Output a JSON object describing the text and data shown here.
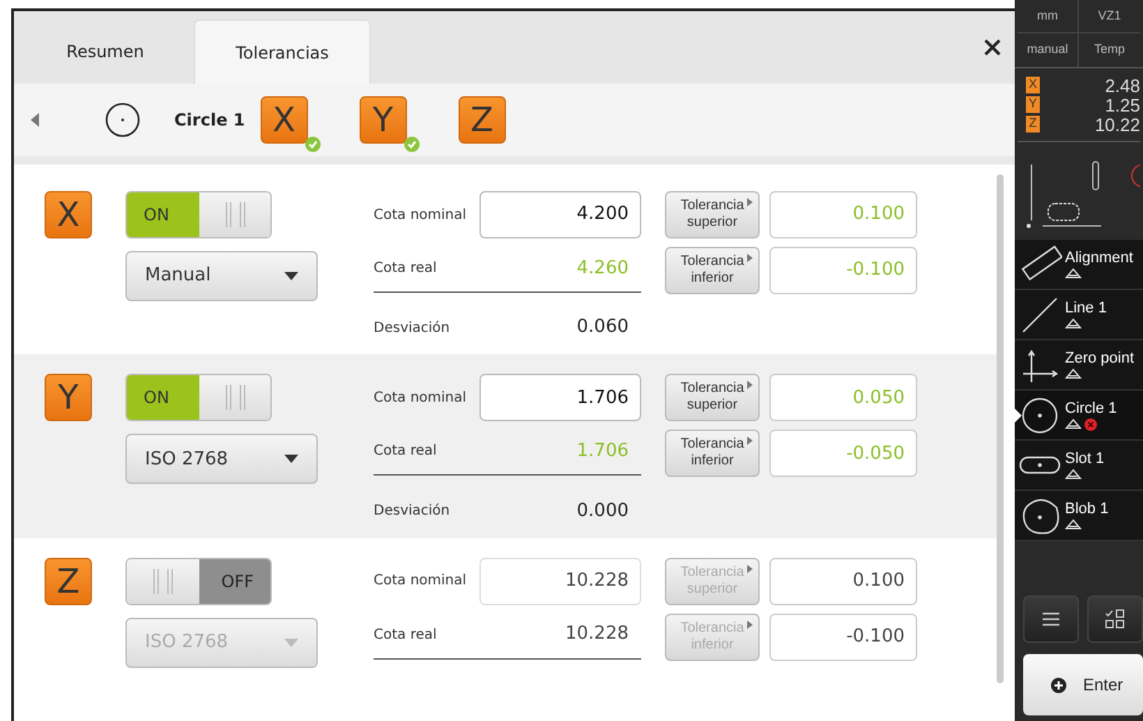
{
  "tabs": [
    {
      "label": "Resumen",
      "selected": false
    },
    {
      "label": "Tolerancias",
      "selected": true
    }
  ],
  "feature": {
    "name": "Circle 1",
    "axes": [
      {
        "label": "X",
        "ok": true
      },
      {
        "label": "Y",
        "ok": true
      },
      {
        "label": "Z",
        "ok": false
      }
    ]
  },
  "rows": [
    {
      "axis": "X",
      "on": true,
      "switch_label": "ON",
      "method": "Manual",
      "nominal_label": "Cota nominal",
      "nominal": "4.200",
      "actual_label": "Cota real",
      "actual": "4.260",
      "deviation_label": "Desviación",
      "deviation": "0.060",
      "upper_label": "Tolerancia superior",
      "upper": "0.100",
      "lower_label": "Tolerancia inferior",
      "lower": "-0.100"
    },
    {
      "axis": "Y",
      "on": true,
      "switch_label": "ON",
      "method": "ISO 2768",
      "nominal_label": "Cota nominal",
      "nominal": "1.706",
      "actual_label": "Cota real",
      "actual": "1.706",
      "deviation_label": "Desviación",
      "deviation": "0.000",
      "upper_label": "Tolerancia superior",
      "upper": "0.050",
      "lower_label": "Tolerancia inferior",
      "lower": "-0.050"
    },
    {
      "axis": "Z",
      "on": false,
      "switch_label": "OFF",
      "method": "ISO 2768",
      "nominal_label": "Cota nominal",
      "nominal": "10.228",
      "actual_label": "Cota real",
      "actual": "10.228",
      "upper_label": "Tolerancia superior",
      "upper": "0.100",
      "lower_label": "Tolerancia inferior",
      "lower": "-0.100"
    }
  ],
  "status": {
    "cells": [
      "mm",
      "VZ1",
      "manual",
      "Temp"
    ]
  },
  "readouts": [
    {
      "axis": "X",
      "value": "2.48"
    },
    {
      "axis": "Y",
      "value": "1.25"
    },
    {
      "axis": "Z",
      "value": "10.22"
    }
  ],
  "features": [
    {
      "name": "Alignment",
      "kind": "alignment",
      "selected": false,
      "error": false
    },
    {
      "name": "Line 1",
      "kind": "line",
      "selected": false,
      "error": false
    },
    {
      "name": "Zero point",
      "kind": "zero",
      "selected": false,
      "error": false
    },
    {
      "name": "Circle 1",
      "kind": "circle",
      "selected": true,
      "error": true
    },
    {
      "name": "Slot 1",
      "kind": "slot",
      "selected": false,
      "error": false
    },
    {
      "name": "Blob 1",
      "kind": "blob",
      "selected": false,
      "error": false
    }
  ],
  "enter": "Enter"
}
